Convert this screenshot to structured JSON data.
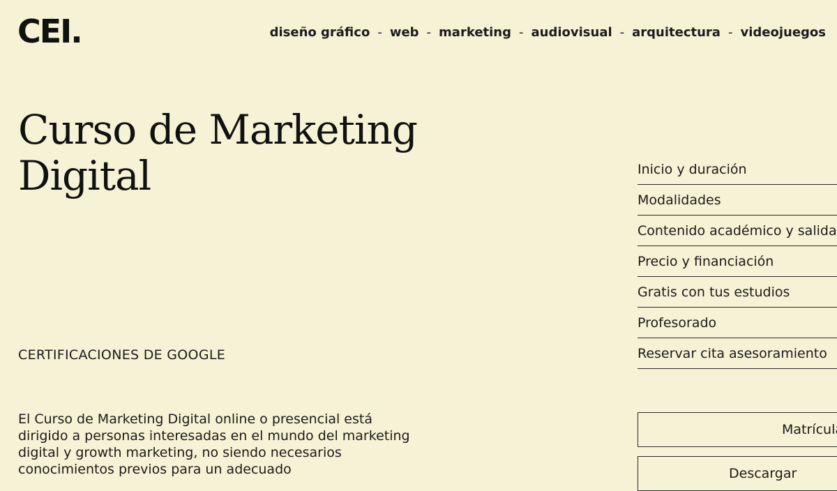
{
  "header": {
    "logo": "CEI.",
    "nav": [
      {
        "label": "diseño gráfico"
      },
      {
        "label": "web"
      },
      {
        "label": "marketing"
      },
      {
        "label": "audiovisual"
      },
      {
        "label": "arquitectura"
      },
      {
        "label": "videojuegos"
      }
    ],
    "separator": "-"
  },
  "main": {
    "title": "Curso de Marketing Digital",
    "subtitle": "CERTIFICACIONES DE GOOGLE",
    "intro": "El Curso de Marketing Digital online o presencial está dirigido a personas interesadas en el mundo del marketing digital y growth marketing, no siendo necesarios conocimientos previos para un adecuado"
  },
  "side_menu": {
    "items": [
      {
        "label": "Inicio y duración"
      },
      {
        "label": "Modalidades"
      },
      {
        "label": "Contenido académico y salidas"
      },
      {
        "label": "Precio y financiación"
      },
      {
        "label": "Gratis con tus estudios"
      },
      {
        "label": "Profesorado"
      },
      {
        "label": "Reservar cita asesoramiento"
      }
    ]
  },
  "cta": {
    "primary_label": "Matrícula",
    "secondary_label": "Descargar"
  },
  "colors": {
    "background": "#f6f2d5",
    "text": "#151515",
    "border": "#2a2a2a"
  }
}
